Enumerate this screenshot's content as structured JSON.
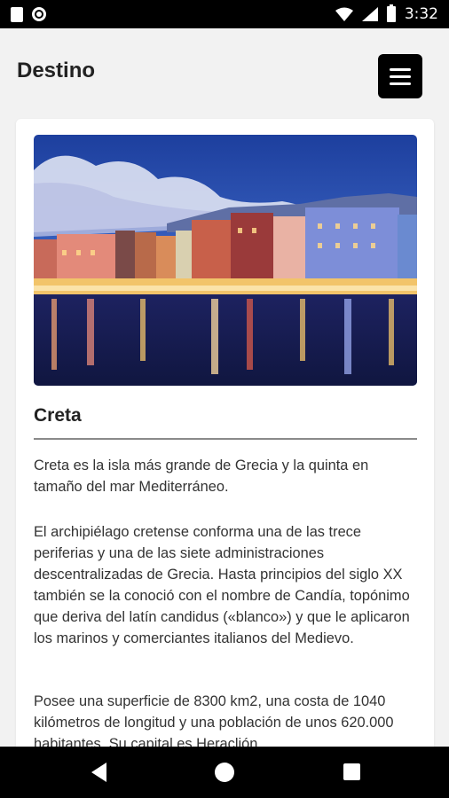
{
  "status_bar": {
    "time": "3:32",
    "icons": [
      "sd-card-icon",
      "circle-icon",
      "wifi-icon",
      "signal-icon",
      "battery-icon"
    ]
  },
  "app_bar": {
    "title": "Destino",
    "menu_icon": "hamburger-menu-icon"
  },
  "card": {
    "image_subject": "harbor-photo",
    "title": "Creta",
    "paragraphs": [
      "Creta es la isla más grande de Grecia y la quinta en tamaño del mar Mediterráneo.",
      "El archipiélago cretense conforma una de las trece periferias y una de las siete administraciones descentralizadas de Grecia. Hasta principios del siglo XX también se la conoció con el nombre de Candía, topónimo que deriva del latín candidus («blanco») y que le aplicaron los marinos y comerciantes italianos del Medievo.",
      "Posee una superficie de 8300 km2, una costa de 1040 kilómetros de longitud y una población de unos 620.000 habitantes. Su capital es Heraclión"
    ]
  },
  "nav_bar": {
    "icons": [
      "back-icon",
      "home-icon",
      "recents-icon"
    ]
  },
  "colors": {
    "background": "#f2f2f2",
    "card": "#ffffff",
    "text": "#333333",
    "menu_button": "#000000"
  }
}
